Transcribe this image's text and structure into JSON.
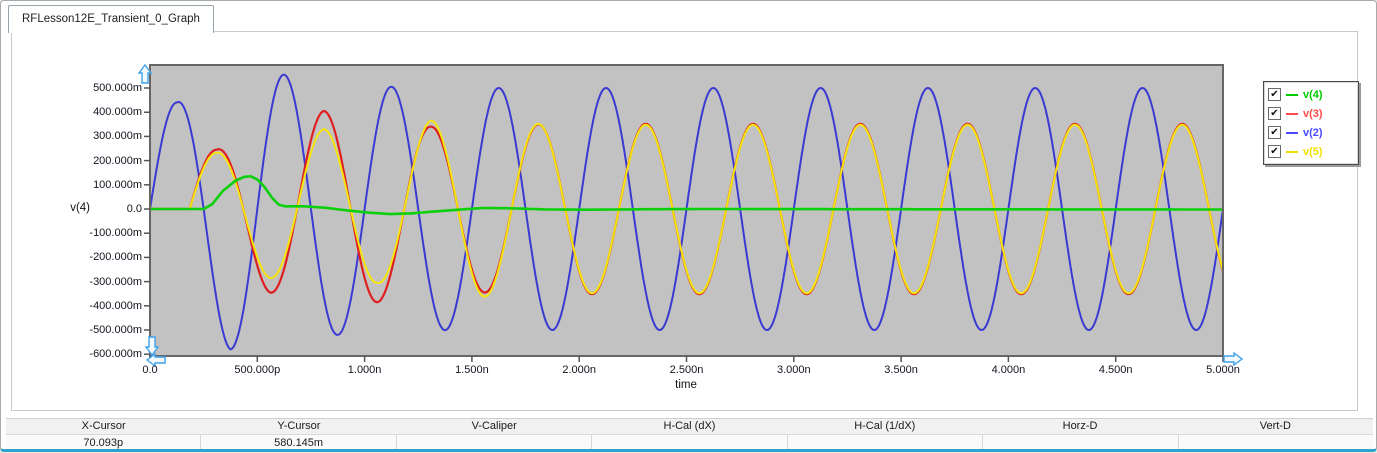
{
  "window": {
    "tab_title": "RFLesson12E_Transient_0_Graph"
  },
  "chart_data": {
    "type": "line",
    "title": "",
    "xlabel": "time",
    "ylabel": "v(4)",
    "grid": false,
    "legend_position": "right-outside",
    "xlim_ns": [
      0,
      5
    ],
    "ylim_mV": [
      -605,
      595
    ],
    "x_ticks": [
      {
        "label": "0.0",
        "t_ns": 0.0
      },
      {
        "label": "500.000p",
        "t_ns": 0.5
      },
      {
        "label": "1.000n",
        "t_ns": 1.0
      },
      {
        "label": "1.500n",
        "t_ns": 1.5
      },
      {
        "label": "2.000n",
        "t_ns": 2.0
      },
      {
        "label": "2.500n",
        "t_ns": 2.5
      },
      {
        "label": "3.000n",
        "t_ns": 3.0
      },
      {
        "label": "3.500n",
        "t_ns": 3.5
      },
      {
        "label": "4.000n",
        "t_ns": 4.0
      },
      {
        "label": "4.500n",
        "t_ns": 4.5
      },
      {
        "label": "5.000n",
        "t_ns": 5.0
      }
    ],
    "y_ticks": [
      {
        "label": "500.000m",
        "v_mV": 500
      },
      {
        "label": "400.000m",
        "v_mV": 400
      },
      {
        "label": "300.000m",
        "v_mV": 300
      },
      {
        "label": "200.000m",
        "v_mV": 200
      },
      {
        "label": "100.000m",
        "v_mV": 100
      },
      {
        "label": "0.0",
        "v_mV": 0
      },
      {
        "label": "-100.000m",
        "v_mV": -100
      },
      {
        "label": "-200.000m",
        "v_mV": -200
      },
      {
        "label": "-300.000m",
        "v_mV": -300
      },
      {
        "label": "-400.000m",
        "v_mV": -400
      },
      {
        "label": "-500.000m",
        "v_mV": -500
      },
      {
        "label": "-600.000m",
        "v_mV": -600
      }
    ],
    "plot_bg": "#c2c2c2",
    "plot_border": "#666666",
    "series": [
      {
        "name": "v(2)",
        "color": "#3a3ad2",
        "model": "sine",
        "period_ns": 0.5,
        "start_ns": 0,
        "amplitude_mV_keyframes": [
          [
            0,
            440
          ],
          [
            0.125,
            440
          ],
          [
            0.375,
            580
          ],
          [
            0.625,
            555
          ],
          [
            0.875,
            520
          ],
          [
            1.125,
            505
          ],
          [
            1.4,
            500
          ],
          [
            5,
            500
          ]
        ],
        "description": "2 GHz sine, steady amplitude 500 mV, transient: first peak 440 mV, first trough -580 mV"
      },
      {
        "name": "v(3)",
        "color": "#de1f1f",
        "model": "sine",
        "period_ns": 0.5,
        "start_ns": 0.185,
        "amplitude_mV_keyframes": [
          [
            0.185,
            245
          ],
          [
            0.31,
            245
          ],
          [
            0.56,
            345
          ],
          [
            0.81,
            405
          ],
          [
            1.06,
            385
          ],
          [
            1.31,
            340
          ],
          [
            1.56,
            345
          ],
          [
            1.9,
            352
          ],
          [
            5,
            352
          ]
        ],
        "description": "2 GHz sine delayed 185 ps, overshoot to 405 mV then settles to 350 mV"
      },
      {
        "name": "v(5)",
        "color": "#f5e50a",
        "model": "sine",
        "period_ns": 0.5,
        "start_ns": 0.185,
        "amplitude_mV_keyframes": [
          [
            0.185,
            232
          ],
          [
            0.31,
            232
          ],
          [
            0.56,
            285
          ],
          [
            0.81,
            330
          ],
          [
            1.06,
            305
          ],
          [
            1.31,
            365
          ],
          [
            1.56,
            362
          ],
          [
            1.9,
            348
          ],
          [
            5,
            348
          ]
        ],
        "description": "2 GHz sine delayed 185 ps, settles to 350 mV, overlaps v(3)"
      },
      {
        "name": "v(4)",
        "color": "#0acf0a",
        "model": "points",
        "points_ns_mV": [
          [
            0,
            0
          ],
          [
            0.25,
            0
          ],
          [
            0.29,
            20
          ],
          [
            0.34,
            75
          ],
          [
            0.4,
            118
          ],
          [
            0.44,
            133
          ],
          [
            0.47,
            135
          ],
          [
            0.5,
            122
          ],
          [
            0.53,
            95
          ],
          [
            0.57,
            45
          ],
          [
            0.6,
            18
          ],
          [
            0.63,
            11
          ],
          [
            0.72,
            11
          ],
          [
            0.82,
            5
          ],
          [
            0.92,
            -6
          ],
          [
            1.02,
            -15
          ],
          [
            1.12,
            -21
          ],
          [
            1.22,
            -18
          ],
          [
            1.33,
            -10
          ],
          [
            1.45,
            -2
          ],
          [
            1.55,
            4
          ],
          [
            1.68,
            3
          ],
          [
            1.85,
            -2
          ],
          [
            2.05,
            -3
          ],
          [
            2.3,
            -1
          ],
          [
            2.6,
            0
          ],
          [
            3.5,
            -1
          ],
          [
            5,
            -2
          ]
        ],
        "description": "pulse ~135 mV peak at 0.45 ns decaying to ~0"
      }
    ]
  },
  "legend": {
    "items": [
      {
        "label": "v(4)",
        "color": "#00cc00",
        "checked": true
      },
      {
        "label": "v(3)",
        "color": "#ff4a4a",
        "checked": true
      },
      {
        "label": "v(2)",
        "color": "#4a4aff",
        "checked": true
      },
      {
        "label": "v(5)",
        "color": "#f0e000",
        "checked": true
      }
    ],
    "checkmark": "✔"
  },
  "scroll_arrows": [
    "up",
    "down",
    "left",
    "right"
  ],
  "cursor_table": {
    "columns": [
      {
        "label": "X-Cursor",
        "value": "70.093p"
      },
      {
        "label": "Y-Cursor",
        "value": "580.145m"
      },
      {
        "label": "V-Caliper",
        "value": ""
      },
      {
        "label": "H-Cal (dX)",
        "value": ""
      },
      {
        "label": "H-Cal (1/dX)",
        "value": ""
      },
      {
        "label": "Horz-D",
        "value": ""
      },
      {
        "label": "Vert-D",
        "value": ""
      }
    ]
  }
}
